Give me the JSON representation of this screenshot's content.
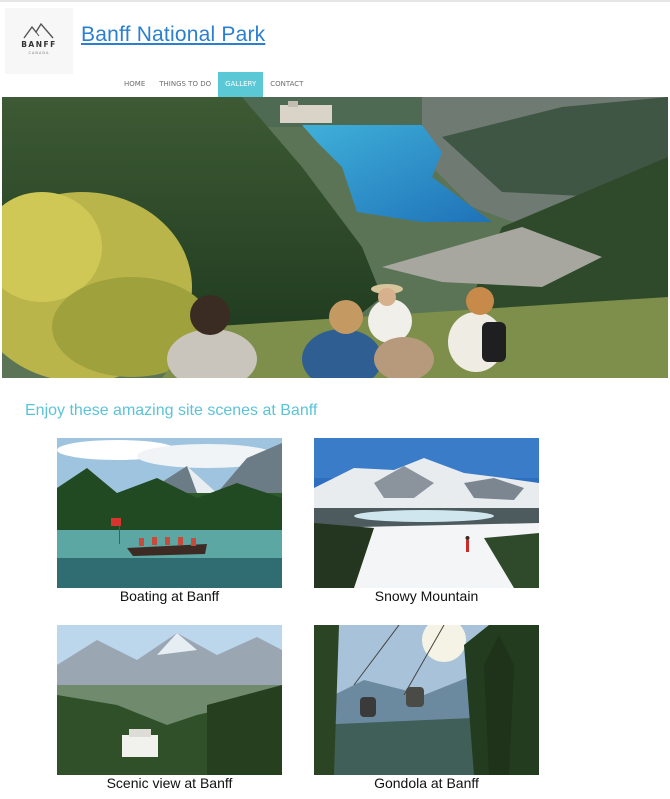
{
  "logo": {
    "brand": "BANFF",
    "sub": "CANADA"
  },
  "site": {
    "title": "Banff National Park"
  },
  "nav": {
    "items": [
      "HOME",
      "THINGS TO DO",
      "GALLERY",
      "CONTACT"
    ],
    "active": "GALLERY"
  },
  "gallery": {
    "heading": "Enjoy these amazing site scenes at Banff",
    "items": [
      {
        "caption": "Boating at Banff"
      },
      {
        "caption": "Snowy Mountain"
      },
      {
        "caption": "Scenic view at Banff"
      },
      {
        "caption": "Gondola at Banff"
      }
    ]
  },
  "colors": {
    "accent": "#5bc8d6",
    "link": "#2a7fd0"
  }
}
